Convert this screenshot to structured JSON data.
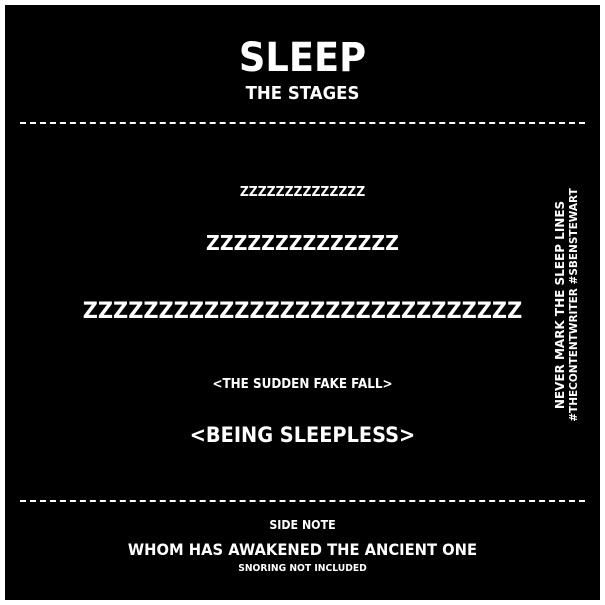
{
  "header": {
    "title": "SLEEP",
    "subtitle": "THE STAGES"
  },
  "stages": {
    "stage1": "ZZZZZZZZZZZZZZ",
    "stage2": "ZZZZZZZZZZZZZZ",
    "stage3": "ZZZZZZZZZZZZZZZZZZZZZZZZZZZZZ",
    "stage4": "<THE SUDDEN FAKE FALL>",
    "stage5": "<BEING SLEEPLESS>"
  },
  "side": {
    "line1": "NEVER MARK THE SLEEP LINES",
    "line2": "#THECONTENTWRITER #SBENSTEWART"
  },
  "footer": {
    "label": "SIDE NOTE",
    "main": "WHOM HAS AWAKENED THE ANCIENT ONE",
    "small": "SNORING NOT INCLUDED"
  },
  "colors": {
    "background": "#000000",
    "text": "#ffffff",
    "border": "#ffffff"
  }
}
